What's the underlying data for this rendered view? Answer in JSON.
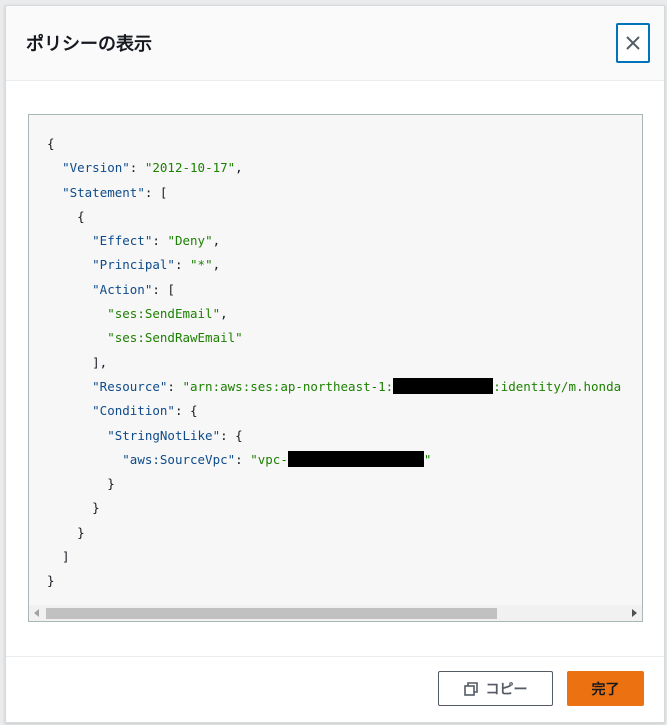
{
  "modal": {
    "title": "ポリシーの表示",
    "copy_label": "コピー",
    "done_label": "完了"
  },
  "policy": {
    "line1": "{",
    "version_key": "\"Version\"",
    "version_val": "\"2012-10-17\"",
    "statement_key": "\"Statement\"",
    "effect_key": "\"Effect\"",
    "effect_val": "\"Deny\"",
    "principal_key": "\"Principal\"",
    "principal_val": "\"*\"",
    "action_key": "\"Action\"",
    "action_1": "\"ses:SendEmail\"",
    "action_2": "\"ses:SendRawEmail\"",
    "resource_key": "\"Resource\"",
    "resource_prefix": "\"arn:aws:ses:ap-northeast-1:",
    "resource_suffix": ":identity/m.honda",
    "condition_key": "\"Condition\"",
    "stringnotlike_key": "\"StringNotLike\"",
    "sourcevpc_key": "\"aws:SourceVpc\"",
    "sourcevpc_prefix": "\"vpc-",
    "sourcevpc_suffix": "\""
  },
  "colors": {
    "primary_button": "#ec7211",
    "close_border": "#0073bb",
    "code_string": "#1d8102"
  }
}
